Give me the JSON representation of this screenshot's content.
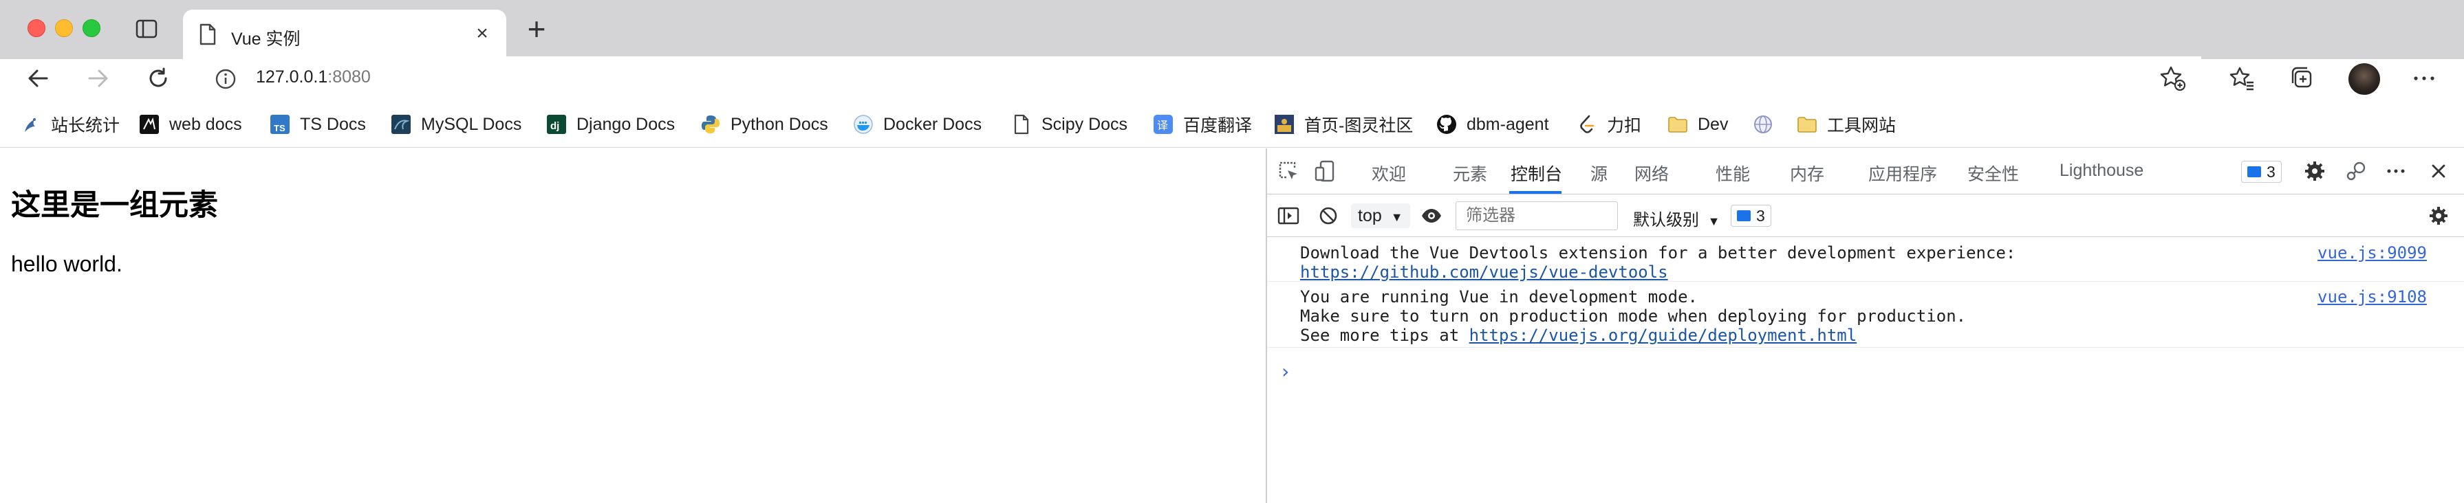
{
  "browser": {
    "tab_title": "Vue 实例",
    "new_tab_symbol": "+",
    "close_symbol": "×",
    "url_host": "127.0.0.1",
    "url_port": ":8080"
  },
  "bookmarks": [
    {
      "label": "站长统计",
      "icon": "bird-icon"
    },
    {
      "label": "web docs",
      "icon": "mdn-icon"
    },
    {
      "label": "TS Docs",
      "icon": "typescript-icon"
    },
    {
      "label": "MySQL Docs",
      "icon": "mysql-icon"
    },
    {
      "label": "Django Docs",
      "icon": "django-icon"
    },
    {
      "label": "Python Docs",
      "icon": "python-icon"
    },
    {
      "label": "Docker Docs",
      "icon": "docker-icon"
    },
    {
      "label": "Scipy Docs",
      "icon": "page-icon"
    },
    {
      "label": "百度翻译",
      "icon": "translate-icon"
    },
    {
      "label": "首页-图灵社区",
      "icon": "turing-icon"
    },
    {
      "label": "dbm-agent",
      "icon": "github-icon"
    },
    {
      "label": "力扣",
      "icon": "leetcode-icon"
    },
    {
      "label": "Dev",
      "icon": "folder-icon"
    },
    {
      "label": "",
      "icon": "globe-icon"
    },
    {
      "label": "工具网站",
      "icon": "folder-icon"
    }
  ],
  "page": {
    "heading": "这里是一组元素",
    "paragraph": "hello world."
  },
  "devtools": {
    "tabs": [
      "欢迎",
      "元素",
      "控制台",
      "源",
      "网络",
      "性能",
      "内存",
      "应用程序",
      "安全性",
      "Lighthouse"
    ],
    "active_tab": "控制台",
    "issue_count": "3",
    "context": "top",
    "filter_placeholder": "筛选器",
    "levels_label": "默认级别",
    "toolbar_issue_count": "3",
    "messages": [
      {
        "lines": [
          "Download the Vue Devtools extension for a better development experience:"
        ],
        "link": "https://github.com/vuejs/vue-devtools",
        "source": "vue.js:9099"
      },
      {
        "lines": [
          "You are running Vue in development mode.",
          "Make sure to turn on production mode when deploying for production."
        ],
        "prefix": "See more tips at ",
        "link": "https://vuejs.org/guide/deployment.html",
        "source": "vue.js:9108"
      }
    ],
    "prompt": "›"
  },
  "colors": {
    "accent": "#1a73e8",
    "link": "#1a55a8",
    "tabstrip": "#d4d4d6"
  }
}
